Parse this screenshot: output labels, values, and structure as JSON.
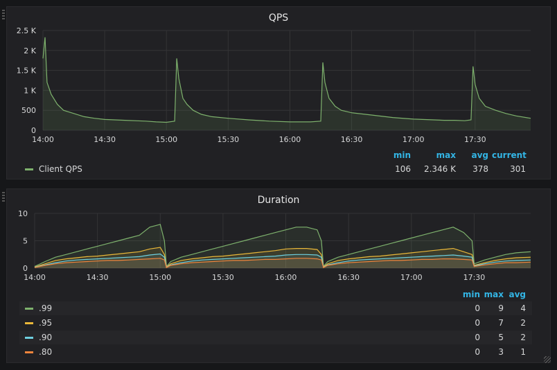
{
  "panels": [
    {
      "title": "QPS",
      "legend_headers": [
        "min",
        "max",
        "avg",
        "current"
      ],
      "legend": [
        {
          "name": "Client QPS",
          "color": "#7eb26d",
          "values": [
            "106",
            "2.346 K",
            "378",
            "301"
          ]
        }
      ]
    },
    {
      "title": "Duration",
      "legend_headers": [
        "min",
        "max",
        "avg"
      ],
      "legend": [
        {
          "name": ".99",
          "color": "#7eb26d",
          "values": [
            "0",
            "9",
            "4"
          ]
        },
        {
          "name": ".95",
          "color": "#eab839",
          "values": [
            "0",
            "7",
            "2"
          ]
        },
        {
          "name": ".90",
          "color": "#6ed0e0",
          "values": [
            "0",
            "5",
            "2"
          ]
        },
        {
          "name": ".80",
          "color": "#ef843c",
          "values": [
            "0",
            "3",
            "1"
          ]
        }
      ]
    }
  ],
  "chart_data": [
    {
      "type": "line",
      "title": "QPS",
      "x_ticks": [
        "14:00",
        "14:30",
        "15:00",
        "15:30",
        "16:00",
        "16:30",
        "17:00",
        "17:30"
      ],
      "y_ticks": [
        "0",
        "500",
        "1 K",
        "1.5 K",
        "2 K",
        "2.5 K"
      ],
      "xlim": [
        "14:00",
        "17:57"
      ],
      "ylim": [
        0,
        2500
      ],
      "grid": true,
      "fill": true,
      "series": [
        {
          "name": "Client QPS",
          "color": "#7eb26d",
          "x": [
            "14:00",
            "14:01",
            "14:02",
            "14:04",
            "14:07",
            "14:10",
            "14:15",
            "14:20",
            "14:25",
            "14:30",
            "14:40",
            "14:50",
            "14:55",
            "15:00",
            "15:04",
            "15:05",
            "15:06",
            "15:08",
            "15:10",
            "15:13",
            "15:17",
            "15:22",
            "15:30",
            "15:40",
            "15:50",
            "16:00",
            "16:10",
            "16:15",
            "16:16",
            "16:17",
            "16:19",
            "16:22",
            "16:25",
            "16:30",
            "16:40",
            "16:50",
            "17:00",
            "17:10",
            "17:15",
            "17:20",
            "17:25",
            "17:28",
            "17:29",
            "17:30",
            "17:32",
            "17:35",
            "17:40",
            "17:45",
            "17:50",
            "17:57"
          ],
          "y": [
            1800,
            2330,
            1200,
            900,
            650,
            500,
            420,
            340,
            300,
            270,
            250,
            230,
            210,
            200,
            230,
            1800,
            1300,
            800,
            650,
            500,
            400,
            340,
            300,
            260,
            230,
            210,
            210,
            230,
            1700,
            1200,
            800,
            600,
            500,
            440,
            380,
            320,
            280,
            260,
            250,
            250,
            240,
            260,
            1600,
            1150,
            800,
            600,
            500,
            420,
            360,
            301
          ]
        }
      ]
    },
    {
      "type": "area",
      "title": "Duration",
      "x_ticks": [
        "14:00",
        "14:30",
        "15:00",
        "15:30",
        "16:00",
        "16:30",
        "17:00",
        "17:30"
      ],
      "y_ticks": [
        "0",
        "5",
        "10"
      ],
      "xlim": [
        "14:00",
        "17:57"
      ],
      "ylim": [
        0,
        10
      ],
      "grid": true,
      "x": [
        "14:00",
        "14:05",
        "14:10",
        "14:15",
        "14:20",
        "14:25",
        "14:30",
        "14:35",
        "14:40",
        "14:45",
        "14:50",
        "14:55",
        "15:00",
        "15:02",
        "15:03",
        "15:05",
        "15:10",
        "15:15",
        "15:20",
        "15:25",
        "15:30",
        "15:35",
        "15:40",
        "15:45",
        "15:50",
        "15:55",
        "16:00",
        "16:05",
        "16:10",
        "16:15",
        "16:17",
        "16:18",
        "16:20",
        "16:25",
        "16:30",
        "16:35",
        "16:40",
        "16:45",
        "16:50",
        "16:55",
        "17:00",
        "17:05",
        "17:10",
        "17:15",
        "17:20",
        "17:25",
        "17:29",
        "17:30",
        "17:35",
        "17:40",
        "17:45",
        "17:50",
        "17:57"
      ],
      "series": [
        {
          "name": ".99",
          "color": "#7eb26d",
          "values": [
            0.3,
            1.2,
            2.0,
            2.5,
            3.0,
            3.5,
            4.0,
            4.5,
            5.0,
            5.5,
            6.0,
            7.5,
            8.0,
            5.0,
            0.3,
            1.2,
            2.0,
            2.5,
            3.0,
            3.5,
            4.0,
            4.5,
            5.0,
            5.5,
            6.0,
            6.5,
            7.0,
            7.5,
            7.5,
            7.0,
            5.0,
            0.3,
            1.2,
            2.0,
            2.5,
            3.0,
            3.5,
            4.0,
            4.5,
            5.0,
            5.5,
            6.0,
            6.5,
            7.0,
            7.5,
            6.5,
            5.0,
            0.8,
            1.5,
            2.0,
            2.5,
            2.8,
            3.0
          ]
        },
        {
          "name": ".95",
          "color": "#eab839",
          "values": [
            0.2,
            0.8,
            1.4,
            1.7,
            1.9,
            2.1,
            2.2,
            2.4,
            2.6,
            2.8,
            3.0,
            3.5,
            3.8,
            2.5,
            0.2,
            0.8,
            1.4,
            1.7,
            1.9,
            2.1,
            2.2,
            2.4,
            2.6,
            2.8,
            3.0,
            3.2,
            3.5,
            3.6,
            3.6,
            3.4,
            2.5,
            0.2,
            0.8,
            1.4,
            1.7,
            1.9,
            2.1,
            2.2,
            2.4,
            2.6,
            2.8,
            3.0,
            3.2,
            3.4,
            3.6,
            3.0,
            2.5,
            0.5,
            1.0,
            1.4,
            1.7,
            1.9,
            2.0
          ]
        },
        {
          "name": ".90",
          "color": "#6ed0e0",
          "values": [
            0.15,
            0.6,
            1.0,
            1.3,
            1.5,
            1.6,
            1.7,
            1.8,
            1.9,
            2.0,
            2.1,
            2.4,
            2.6,
            2.0,
            0.15,
            0.6,
            1.0,
            1.3,
            1.5,
            1.6,
            1.7,
            1.8,
            1.9,
            2.0,
            2.1,
            2.2,
            2.4,
            2.5,
            2.5,
            2.4,
            2.0,
            0.15,
            0.6,
            1.0,
            1.3,
            1.5,
            1.6,
            1.7,
            1.8,
            1.9,
            2.0,
            2.1,
            2.2,
            2.3,
            2.4,
            2.2,
            2.0,
            0.4,
            0.8,
            1.1,
            1.3,
            1.4,
            1.5
          ]
        },
        {
          "name": ".80",
          "color": "#ef843c",
          "values": [
            0.1,
            0.5,
            0.8,
            1.0,
            1.1,
            1.2,
            1.3,
            1.4,
            1.4,
            1.5,
            1.6,
            1.7,
            1.8,
            1.5,
            0.1,
            0.5,
            0.8,
            1.0,
            1.1,
            1.2,
            1.3,
            1.4,
            1.4,
            1.5,
            1.6,
            1.6,
            1.7,
            1.8,
            1.8,
            1.7,
            1.5,
            0.1,
            0.5,
            0.8,
            1.0,
            1.1,
            1.2,
            1.3,
            1.4,
            1.4,
            1.5,
            1.6,
            1.6,
            1.7,
            1.7,
            1.6,
            1.5,
            0.3,
            0.6,
            0.8,
            1.0,
            1.0,
            1.1
          ]
        }
      ]
    }
  ]
}
